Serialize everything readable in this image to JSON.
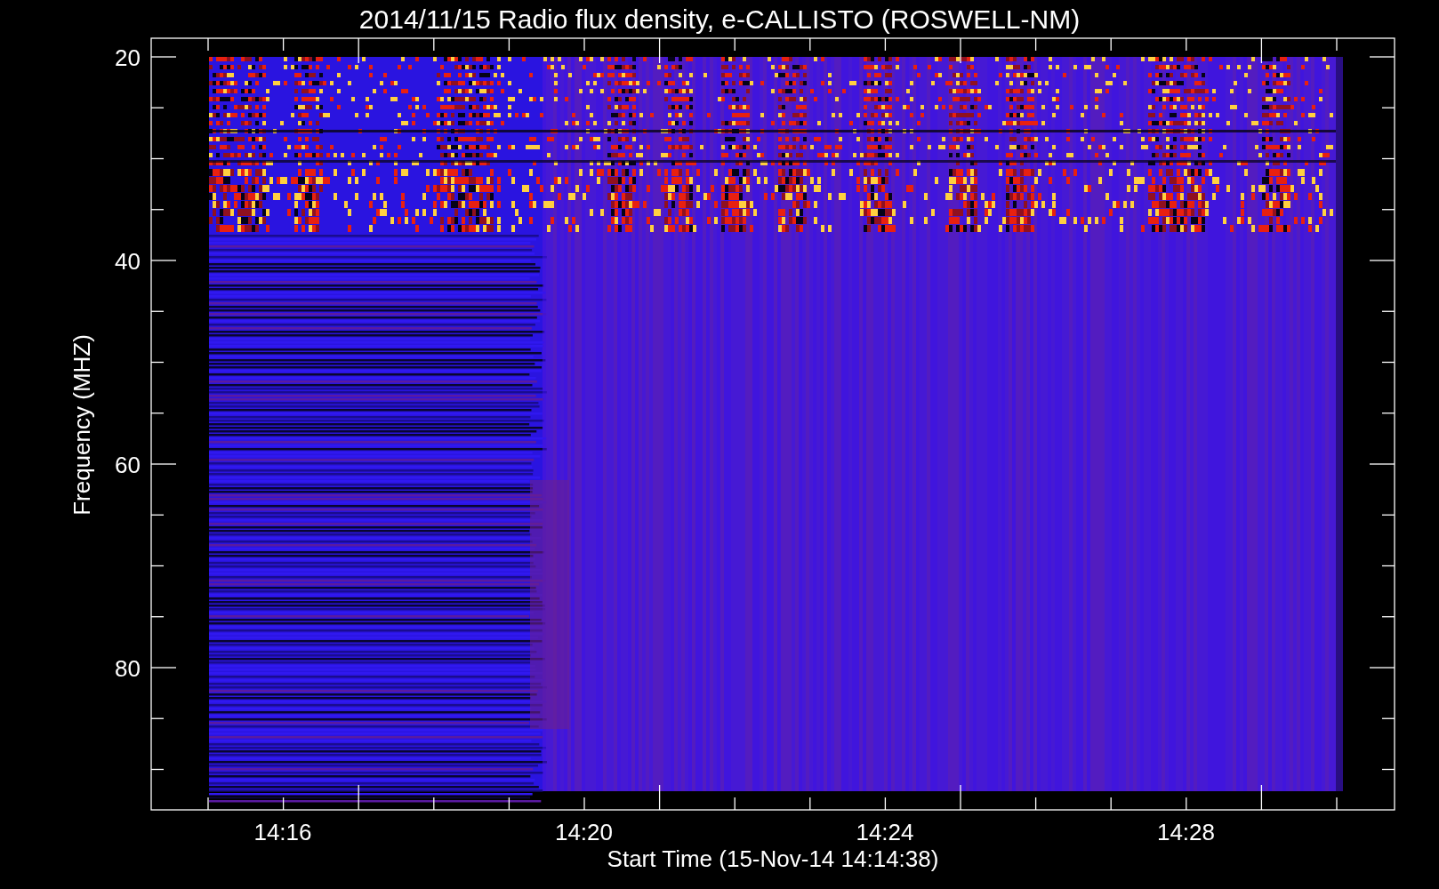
{
  "title": "2014/11/15  Radio flux density, e-CALLISTO (ROSWELL-NM)",
  "y_axis": {
    "label": "Frequency (MHZ)",
    "ticks": [
      "20",
      "40",
      "60",
      "80"
    ]
  },
  "x_axis": {
    "label": "Start Time (15-Nov-14 14:14:38)",
    "ticks": [
      "14:16",
      "14:20",
      "14:24",
      "14:28"
    ]
  }
}
